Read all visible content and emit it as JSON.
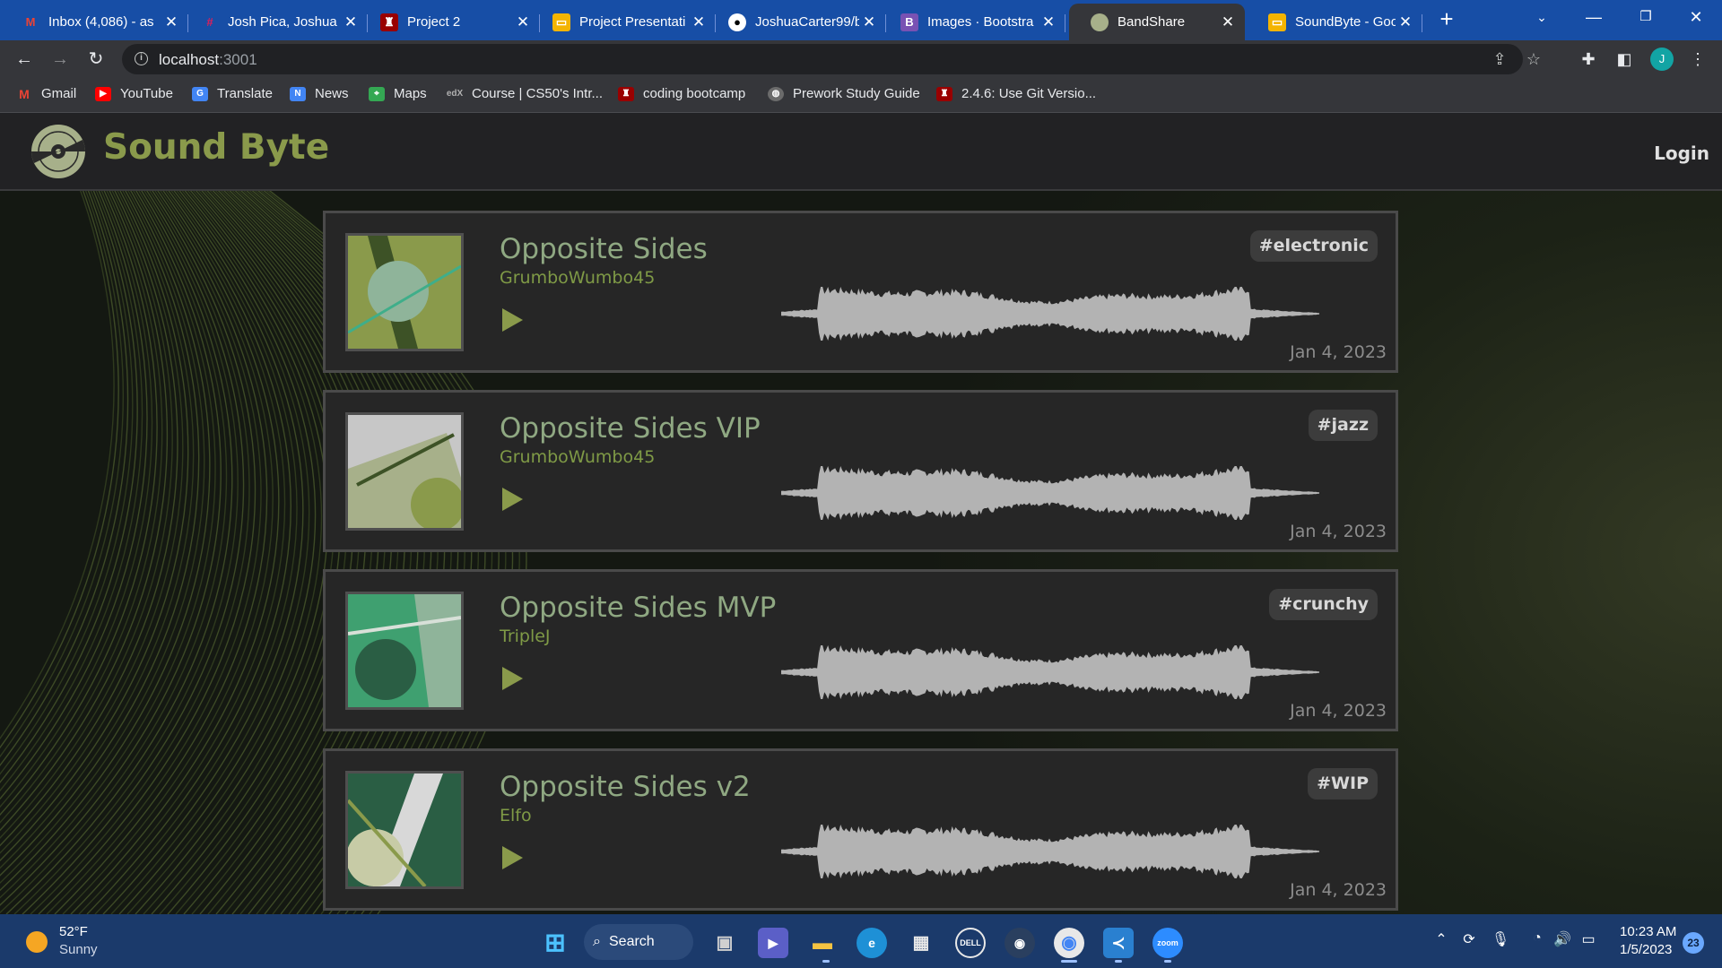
{
  "browser": {
    "tabs": [
      {
        "title": "Inbox (4,086) - as",
        "icon": "gmail-icon",
        "color": "#ea4335"
      },
      {
        "title": "Josh Pica, Joshua",
        "icon": "slack-icon",
        "color": "#e01e5a"
      },
      {
        "title": "Project 2",
        "icon": "penn-shield-icon",
        "color": "#990000"
      },
      {
        "title": "Project Presentati",
        "icon": "google-slides-icon",
        "color": "#f4b400"
      },
      {
        "title": "JoshuaCarter99/b",
        "icon": "github-icon",
        "color": "#ffffff"
      },
      {
        "title": "Images · Bootstra",
        "icon": "bootstrap-icon",
        "color": "#7952b3"
      },
      {
        "title": "BandShare",
        "icon": "bandshare-icon",
        "color": "#a7b08a"
      },
      {
        "title": "SoundByte - Goo",
        "icon": "google-slides-icon",
        "color": "#f4b400"
      }
    ],
    "new_tab": "+",
    "url": {
      "host": "localhost",
      "port": ":3001"
    },
    "profile_initial": "J",
    "bookmarks": [
      {
        "label": "Gmail",
        "icon": "gmail-icon"
      },
      {
        "label": "YouTube",
        "icon": "youtube-icon"
      },
      {
        "label": "Translate",
        "icon": "translate-icon"
      },
      {
        "label": "News",
        "icon": "news-icon"
      },
      {
        "label": "Maps",
        "icon": "maps-icon"
      },
      {
        "label": "Course | CS50's Intr...",
        "icon": "edx-icon"
      },
      {
        "label": "coding bootcamp",
        "icon": "penn-shield-icon"
      },
      {
        "label": "Prework Study Guide",
        "icon": "globe-icon"
      },
      {
        "label": "2.4.6: Use Git Versio...",
        "icon": "penn-shield-icon"
      }
    ]
  },
  "site": {
    "brand": "Sound Byte",
    "login_label": "Login",
    "colors": {
      "brand": "#8a9a4b",
      "title": "#8fa882",
      "artist": "#7f9a46",
      "play": "#8a9a4b"
    }
  },
  "tracks": [
    {
      "title": "Opposite Sides",
      "artist": "GrumboWumbo45",
      "tag": "#electronic",
      "date": "Jan 4, 2023",
      "cover": "cover-art-1"
    },
    {
      "title": "Opposite Sides VIP",
      "artist": "GrumboWumbo45",
      "tag": "#jazz",
      "date": "Jan 4, 2023",
      "cover": "cover-art-2"
    },
    {
      "title": "Opposite Sides MVP",
      "artist": "TripleJ",
      "tag": "#crunchy",
      "date": "Jan 4, 2023",
      "cover": "cover-art-3"
    },
    {
      "title": "Opposite Sides v2",
      "artist": "Elfo",
      "tag": "#WIP",
      "date": "Jan 4, 2023",
      "cover": "cover-art-4"
    }
  ],
  "taskbar": {
    "weather_temp": "52°F",
    "weather_condition": "Sunny",
    "search_label": "Search",
    "time": "10:23 AM",
    "date": "1/5/2023",
    "notification_count": "23"
  }
}
